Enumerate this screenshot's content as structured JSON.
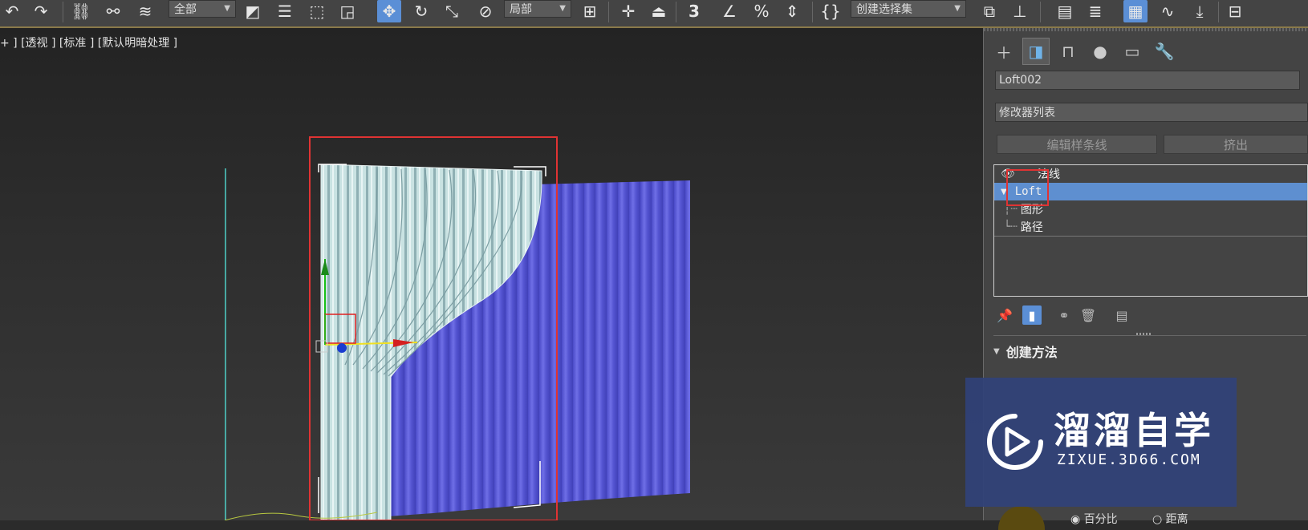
{
  "toolbar": {
    "filter_dropdown": "全部",
    "coord_dropdown": "局部",
    "named_selection": "创建选择集",
    "snap_label": "3"
  },
  "viewport": {
    "label": "+ ] [透视 ] [标准 ] [默认明暗处理 ]"
  },
  "panel": {
    "object_name": "Loft002",
    "modifier_list": "修改器列表",
    "quick_buttons": [
      "编辑样条线",
      "挤出"
    ],
    "stack": {
      "top_item": "法线",
      "selected_item": "Loft",
      "children": [
        "图形",
        "路径"
      ]
    },
    "rollout_create_method": "创建方法",
    "options": [
      "百分比",
      "距离"
    ]
  },
  "watermark": {
    "title": "溜溜自学",
    "subtitle": "ZIXUE.3D66.COM"
  },
  "colors": {
    "accent": "#5b8fd6",
    "highlight_box": "#e03333",
    "curtain_front": "#bcdada",
    "curtain_back": "#5a5ad6"
  }
}
